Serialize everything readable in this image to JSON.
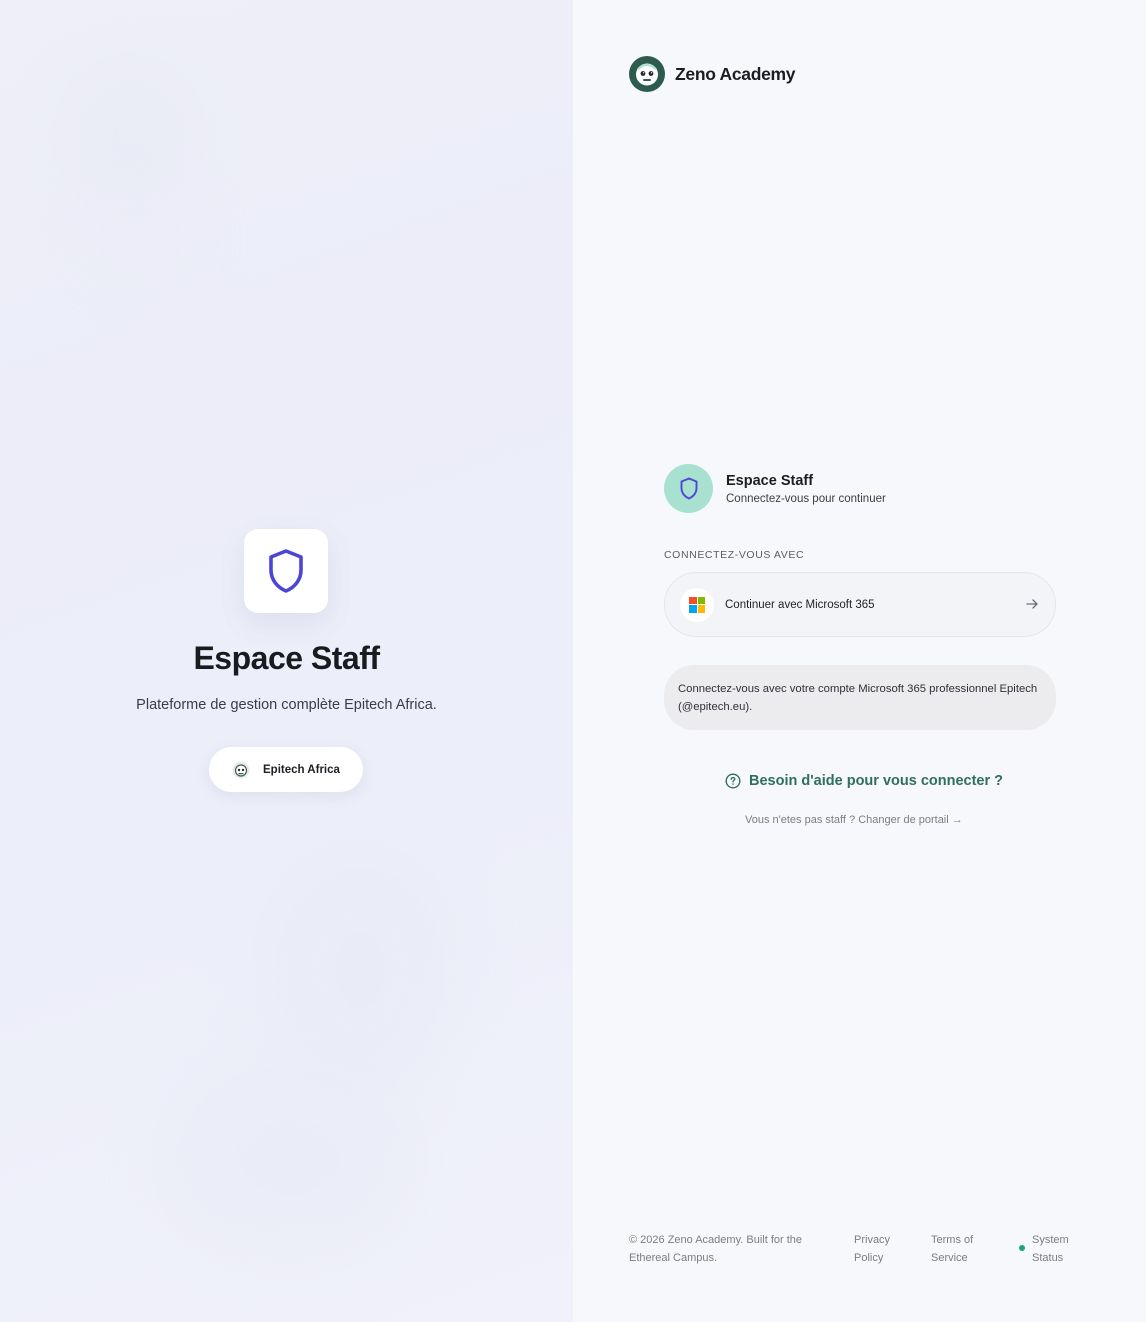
{
  "left_panel": {
    "title": "Espace Staff",
    "subtitle": "Plateforme de gestion complète Epitech Africa.",
    "campus_pill": "Epitech Africa"
  },
  "brand": {
    "name": "Zeno Academy",
    "logo_icon": "robot-mascot-icon"
  },
  "login": {
    "title": "Espace Staff",
    "subtitle": "Connectez-vous pour continuer",
    "connect_with_label": "CONNECTEZ-VOUS AVEC",
    "microsoft_button_label": "Continuer avec Microsoft 365",
    "info_text": "Connectez-vous avec votre compte Microsoft 365 professionnel Epitech (@epitech.eu).",
    "help_link": "Besoin d'aide pour vous connecter ?",
    "switch_portal_link": "Vous n'etes pas staff ? Changer de portail →"
  },
  "footer": {
    "copyright": "© 2026 Zeno Academy. Built for the Ethereal Campus.",
    "privacy": "Privacy Policy",
    "terms": "Terms of Service",
    "status": "System Status"
  },
  "colors": {
    "accent_green": "#2f6f5c",
    "shield_purple": "#4b46d6",
    "status_green": "#1aa874",
    "staff_circle": "#a9e1d1"
  }
}
